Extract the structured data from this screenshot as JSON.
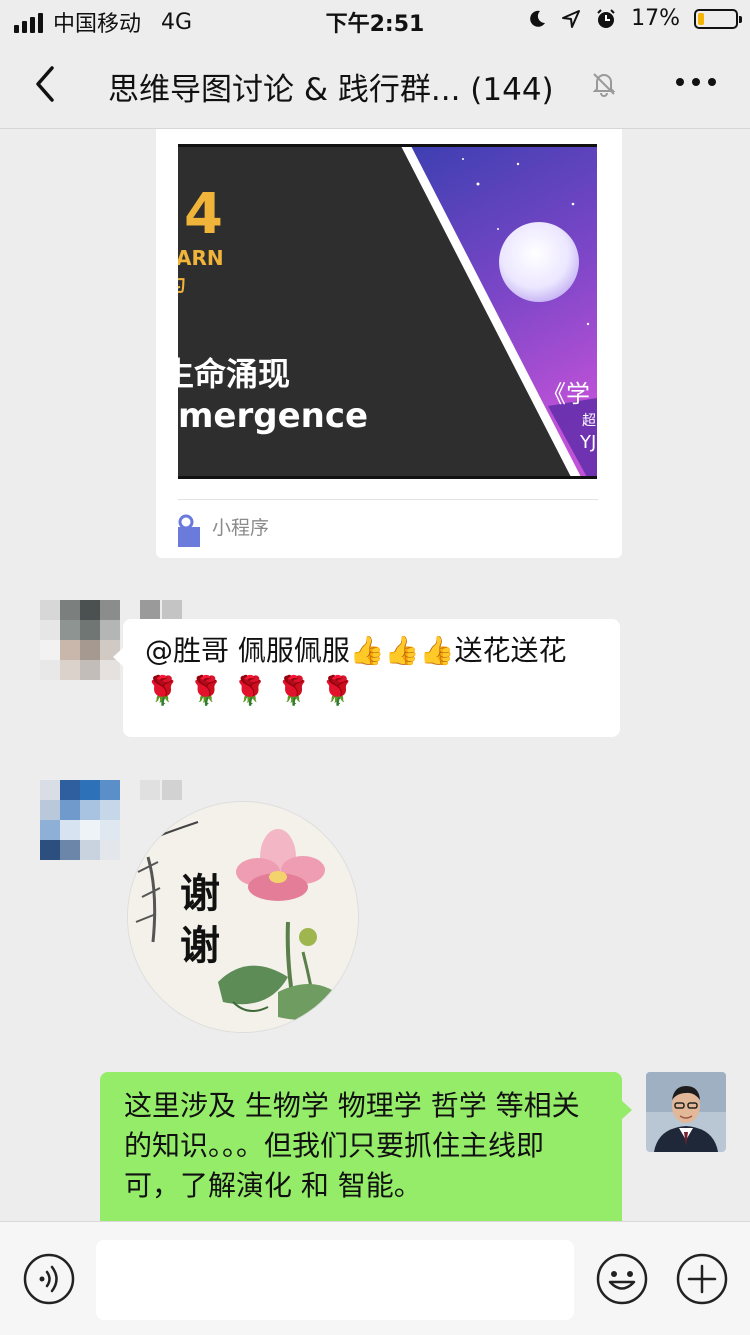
{
  "status_bar": {
    "carrier": "中国移动",
    "network": "4G",
    "time": "下午2:51",
    "battery_percent": "17%",
    "battery_level": 0.17
  },
  "nav": {
    "title": "思维导图讨论 & 践行群... (144)"
  },
  "messages": {
    "mini_program": {
      "big_number": "4",
      "learn_text": "ARN",
      "small_glyph": "匀",
      "cn_title": "生命涌现",
      "en_title": "mergence",
      "side_text_1": "《学",
      "side_text_2": "超",
      "side_text_3": "YJ",
      "label": "小程序"
    },
    "incoming_1": {
      "text": "@胜哥 佩服佩服👍👍👍送花送花🌹 🌹 🌹 🌹 🌹"
    },
    "sticker": {
      "text": "谢谢"
    },
    "outgoing_1": {
      "text": "这里涉及 生物学 物理学 哲学 等相关的知识。。。但我们只要抓住主线即可，了解演化 和 智能。"
    }
  },
  "input": {
    "placeholder": ""
  },
  "icons": {
    "voice": "voice-icon",
    "emoji": "emoji-icon",
    "plus": "plus-icon",
    "back": "back-chevron-icon",
    "mute": "bell-muted-icon",
    "more": "more-dots-icon"
  },
  "colors": {
    "outgoing_bubble": "#95ec69",
    "incoming_bubble": "#ffffff",
    "background": "#ededed",
    "battery_fill": "#f5b400"
  }
}
